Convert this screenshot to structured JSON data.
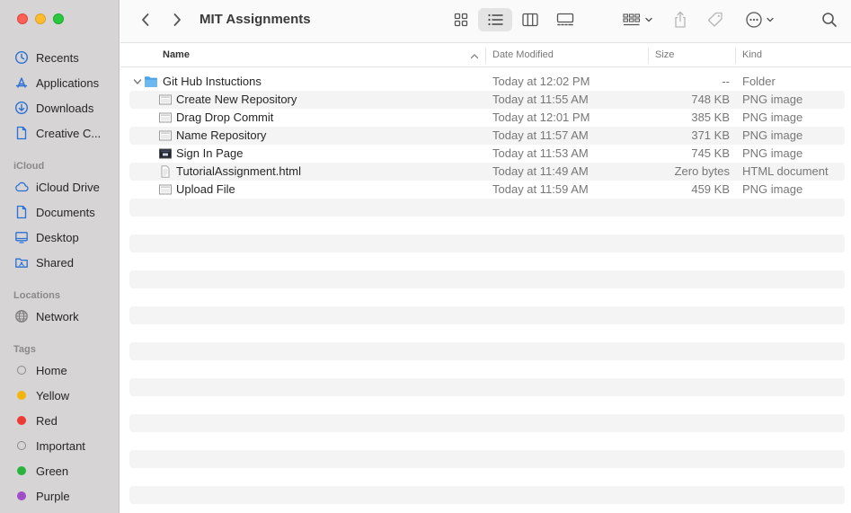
{
  "window": {
    "title": "MIT Assignments"
  },
  "sidebar": {
    "favorites": [
      {
        "label": "Recents",
        "icon": "clock-icon"
      },
      {
        "label": "Applications",
        "icon": "applications-icon"
      },
      {
        "label": "Downloads",
        "icon": "download-icon"
      },
      {
        "label": "Creative C...",
        "icon": "document-icon"
      }
    ],
    "icloud_heading": "iCloud",
    "icloud": [
      {
        "label": "iCloud Drive",
        "icon": "cloud-icon"
      },
      {
        "label": "Documents",
        "icon": "document-icon"
      },
      {
        "label": "Desktop",
        "icon": "desktop-icon"
      },
      {
        "label": "Shared",
        "icon": "shared-folder-icon"
      }
    ],
    "locations_heading": "Locations",
    "locations": [
      {
        "label": "Network",
        "icon": "globe-icon"
      }
    ],
    "tags_heading": "Tags",
    "tags": [
      {
        "label": "Home",
        "color": "",
        "hollow": true
      },
      {
        "label": "Yellow",
        "color": "#f5b40a",
        "hollow": false
      },
      {
        "label": "Red",
        "color": "#ee3a32",
        "hollow": false
      },
      {
        "label": "Important",
        "color": "",
        "hollow": true
      },
      {
        "label": "Green",
        "color": "#2bb43c",
        "hollow": false
      },
      {
        "label": "Purple",
        "color": "#a04ccb",
        "hollow": false
      }
    ]
  },
  "columns": {
    "name": "Name",
    "date_modified": "Date Modified",
    "size": "Size",
    "kind": "Kind"
  },
  "files": [
    {
      "name": "Git Hub Instuctions",
      "date": "Today at 12:02 PM",
      "size": "--",
      "kind": "Folder",
      "type": "folder"
    },
    {
      "name": "Create New Repository",
      "date": "Today at 11:55 AM",
      "size": "748 KB",
      "kind": "PNG image",
      "type": "image"
    },
    {
      "name": "Drag Drop Commit",
      "date": "Today at 12:01 PM",
      "size": "385 KB",
      "kind": "PNG image",
      "type": "image"
    },
    {
      "name": "Name Repository",
      "date": "Today at 11:57 AM",
      "size": "371 KB",
      "kind": "PNG image",
      "type": "image"
    },
    {
      "name": "Sign In Page",
      "date": "Today at 11:53 AM",
      "size": "745 KB",
      "kind": "PNG image",
      "type": "image-dark"
    },
    {
      "name": "TutorialAssignment.html",
      "date": "Today at 11:49 AM",
      "size": "Zero bytes",
      "kind": "HTML document",
      "type": "html"
    },
    {
      "name": "Upload File",
      "date": "Today at 11:59 AM",
      "size": "459 KB",
      "kind": "PNG image",
      "type": "image"
    }
  ],
  "colors": {
    "sidebar_bg": "#d6d4d4",
    "folder_blue": "#5aa9e6",
    "accent": "#2a6fd6"
  }
}
